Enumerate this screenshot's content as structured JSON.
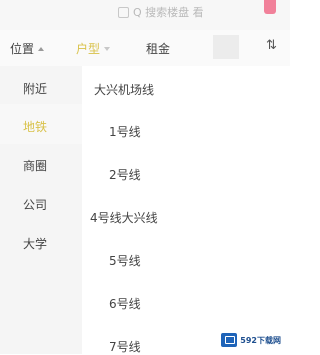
{
  "topbar": {
    "search_hint": "Q 搜索楼盘 看"
  },
  "filters": [
    {
      "label": "位置",
      "state": "open"
    },
    {
      "label": "户型",
      "state": "closed"
    },
    {
      "label": "租金"
    }
  ],
  "sort_icon": "⇅",
  "categories": [
    "附近",
    "地铁",
    "商圈",
    "公司",
    "大学"
  ],
  "selected_category": "地铁",
  "lines": [
    "大兴机场线",
    "1号线",
    "2号线",
    "4号线大兴线",
    "5号线",
    "6号线",
    "7号线"
  ],
  "watermark": {
    "text": "592下载网"
  },
  "colors": {
    "accent": "#d9c24a",
    "watermark": "#1e63b8"
  }
}
